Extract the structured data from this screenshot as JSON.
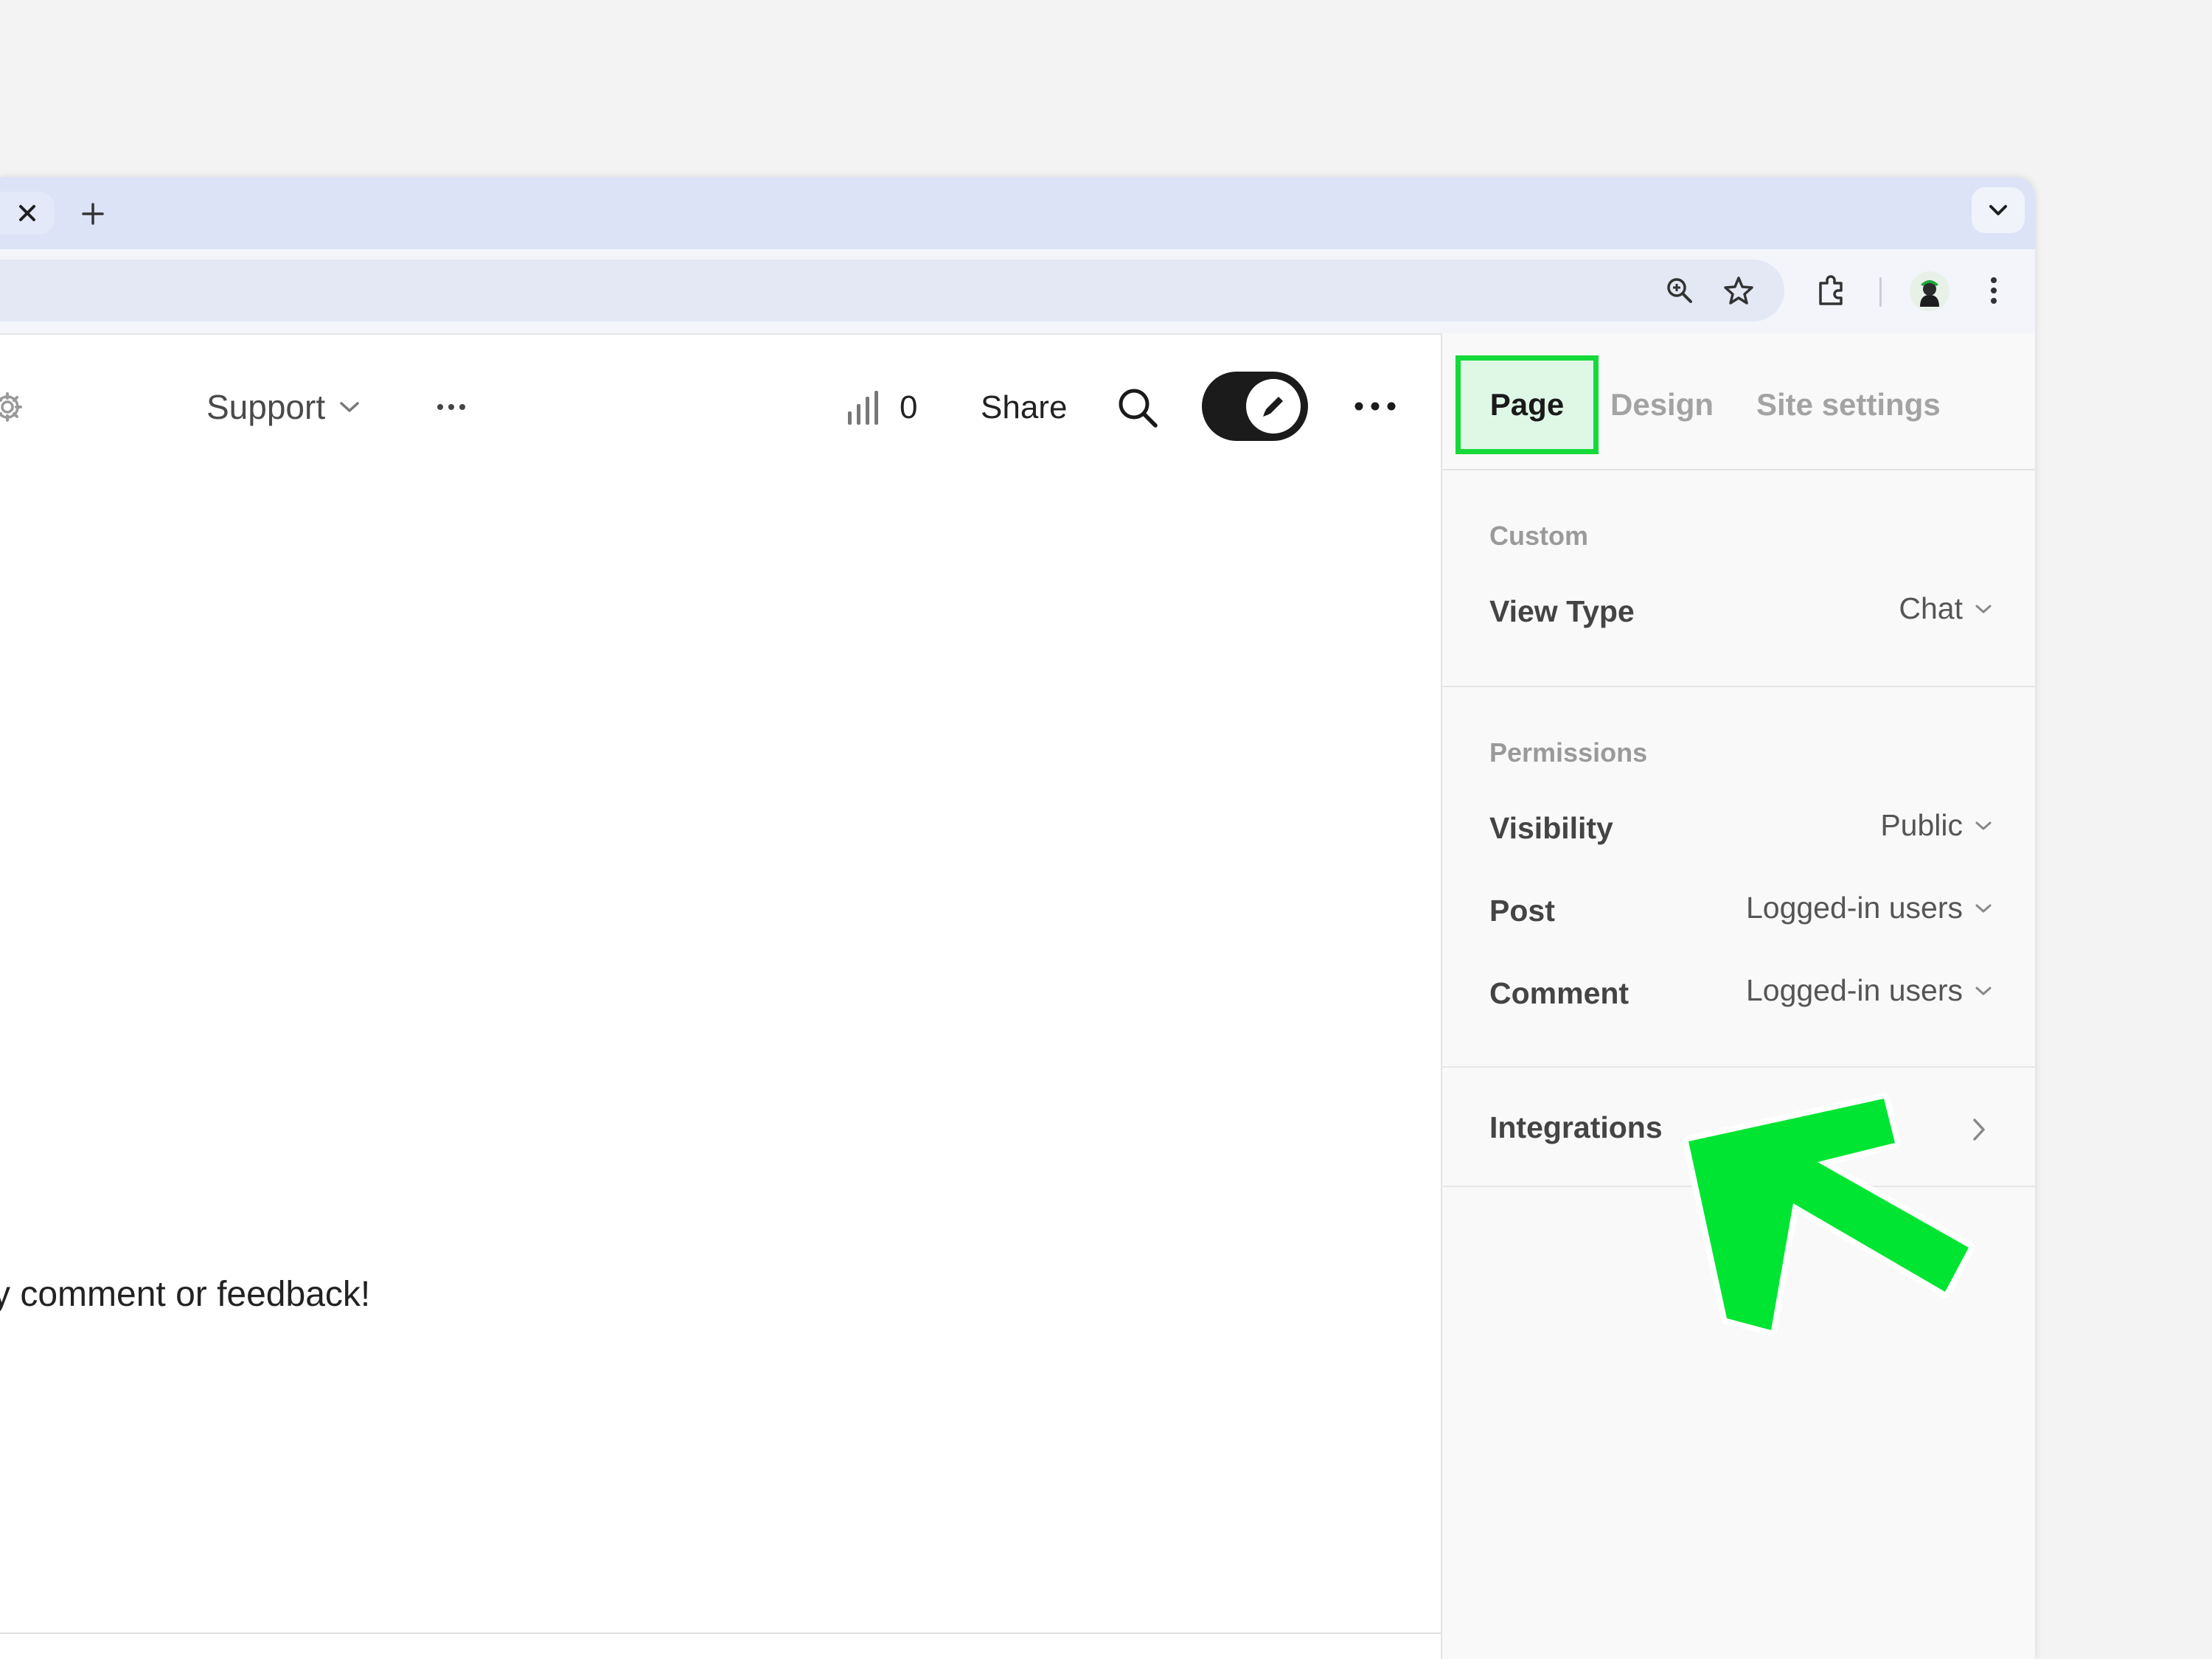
{
  "browser": {
    "tab_close_symbol": "×",
    "new_tab_symbol": "+",
    "icons": [
      "zoom-icon",
      "bookmark-star-icon",
      "extensions-icon",
      "kebab-menu-icon",
      "tab-search-icon"
    ]
  },
  "header": {
    "menu_label": "Support",
    "stats_count": "0",
    "share_label": "Share",
    "edit_mode_on": true
  },
  "content": {
    "message_partial": "y comment or feedback!"
  },
  "panel": {
    "tabs": [
      {
        "label": "Page",
        "active": true
      },
      {
        "label": "Design",
        "active": false
      },
      {
        "label": "Site settings",
        "active": false
      }
    ],
    "custom": {
      "heading": "Custom",
      "view_type_label": "View Type",
      "view_type_value": "Chat"
    },
    "permissions": {
      "heading": "Permissions",
      "rows": [
        {
          "label": "Visibility",
          "value": "Public"
        },
        {
          "label": "Post",
          "value": "Logged-in users"
        },
        {
          "label": "Comment",
          "value": "Logged-in users"
        }
      ]
    },
    "integrations_label": "Integrations"
  },
  "annotation": {
    "highlight_color": "#16d93a",
    "arrow_color": "#00e532"
  }
}
